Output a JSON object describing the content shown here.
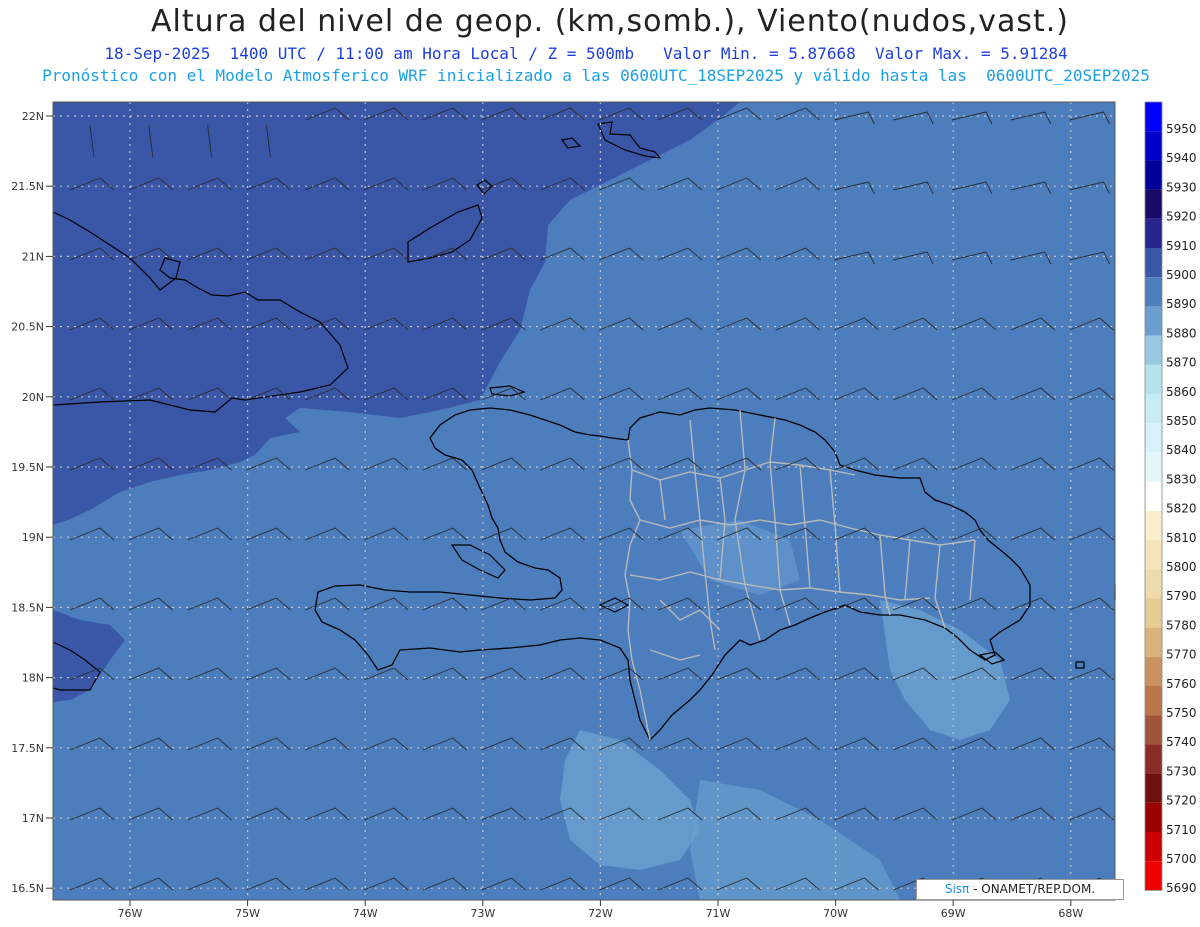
{
  "header": {
    "title": "Altura del nivel de geop. (km,somb.), Viento(nudos,vast.)",
    "subtitle": "18-Sep-2025  1400 UTC / 11:00 am Hora Local / Z = 500mb   Valor Min. = 5.87668  Valor Max. = 5.91284",
    "model_line": "Pronóstico con el Modelo Atmosferico WRF inicializado a las 0600UTC_18SEP2025 y válido hasta las  0600UTC_20SEP2025"
  },
  "axes": {
    "lat_labels": [
      "22N",
      "21.5N",
      "21N",
      "20.5N",
      "20N",
      "19.5N",
      "19N",
      "18.5N",
      "18N",
      "17.5N",
      "17N",
      "16.5N"
    ],
    "lon_labels": [
      "76W",
      "75W",
      "74W",
      "73W",
      "72W",
      "71W",
      "70W",
      "69W",
      "68W"
    ]
  },
  "legend": {
    "levels": [
      "5950",
      "5940",
      "5930",
      "5920",
      "5910",
      "5900",
      "5890",
      "5880",
      "5870",
      "5860",
      "5850",
      "5840",
      "5830",
      "5820",
      "5810",
      "5800",
      "5790",
      "5780",
      "5770",
      "5760",
      "5750",
      "5740",
      "5730",
      "5720",
      "5710",
      "5700",
      "5690"
    ],
    "colors": [
      "#0000ff",
      "#0000cc",
      "#000099",
      "#1a0a66",
      "#26268f",
      "#3a56a7",
      "#4c7dbd",
      "#6a9fd0",
      "#96c8e4",
      "#b6e2ef",
      "#c8ecf4",
      "#d8f1f7",
      "#e3f6fb",
      "#ffffff",
      "#faefcd",
      "#f6e5bc",
      "#efdbab",
      "#e7cb95",
      "#d9b27c",
      "#c99260",
      "#b8764a",
      "#a05538",
      "#8a2c25",
      "#6e1010",
      "#990000",
      "#cc0000",
      "#ee0000"
    ]
  },
  "credit": {
    "brand": "Sisπ",
    "text": "- ONAMET/REP.DOM."
  },
  "colors": {
    "title": "#222222",
    "subtitle": "#1f3fe0",
    "model_line": "#1aa0e8"
  }
}
